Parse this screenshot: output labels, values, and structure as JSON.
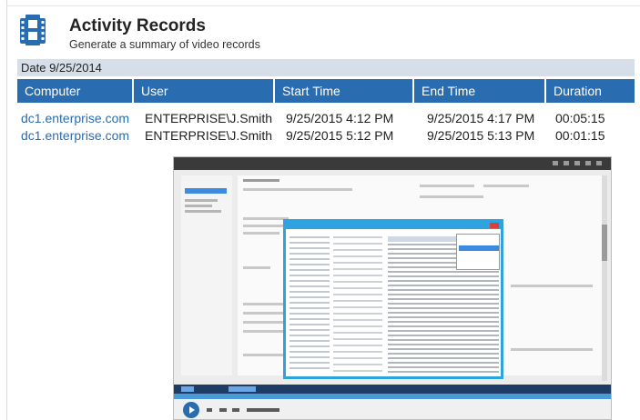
{
  "header": {
    "title": "Activity Records",
    "subtitle": "Generate a summary of video records",
    "icon": "film-icon",
    "accent": "#2a6cb0"
  },
  "report": {
    "date_label": "Date 9/25/2014",
    "columns": [
      "Computer",
      "User",
      "Start Time",
      "End Time",
      "Duration"
    ],
    "rows": [
      {
        "computer": "dc1.enterprise.com",
        "user": "ENTERPRISE\\J.Smith",
        "start": "9/25/2015 4:12 PM",
        "end": "9/25/2015 4:17 PM",
        "duration": "00:05:15"
      },
      {
        "computer": "dc1.enterprise.com",
        "user": "ENTERPRISE\\J.Smith",
        "start": "9/25/2015 5:12 PM",
        "end": "9/25/2015 5:13 PM",
        "duration": "00:01:15"
      }
    ]
  },
  "colors": {
    "header_fill": "#2a6cb0",
    "date_bar": "#d6dfe9",
    "link": "#2a6cb0"
  }
}
